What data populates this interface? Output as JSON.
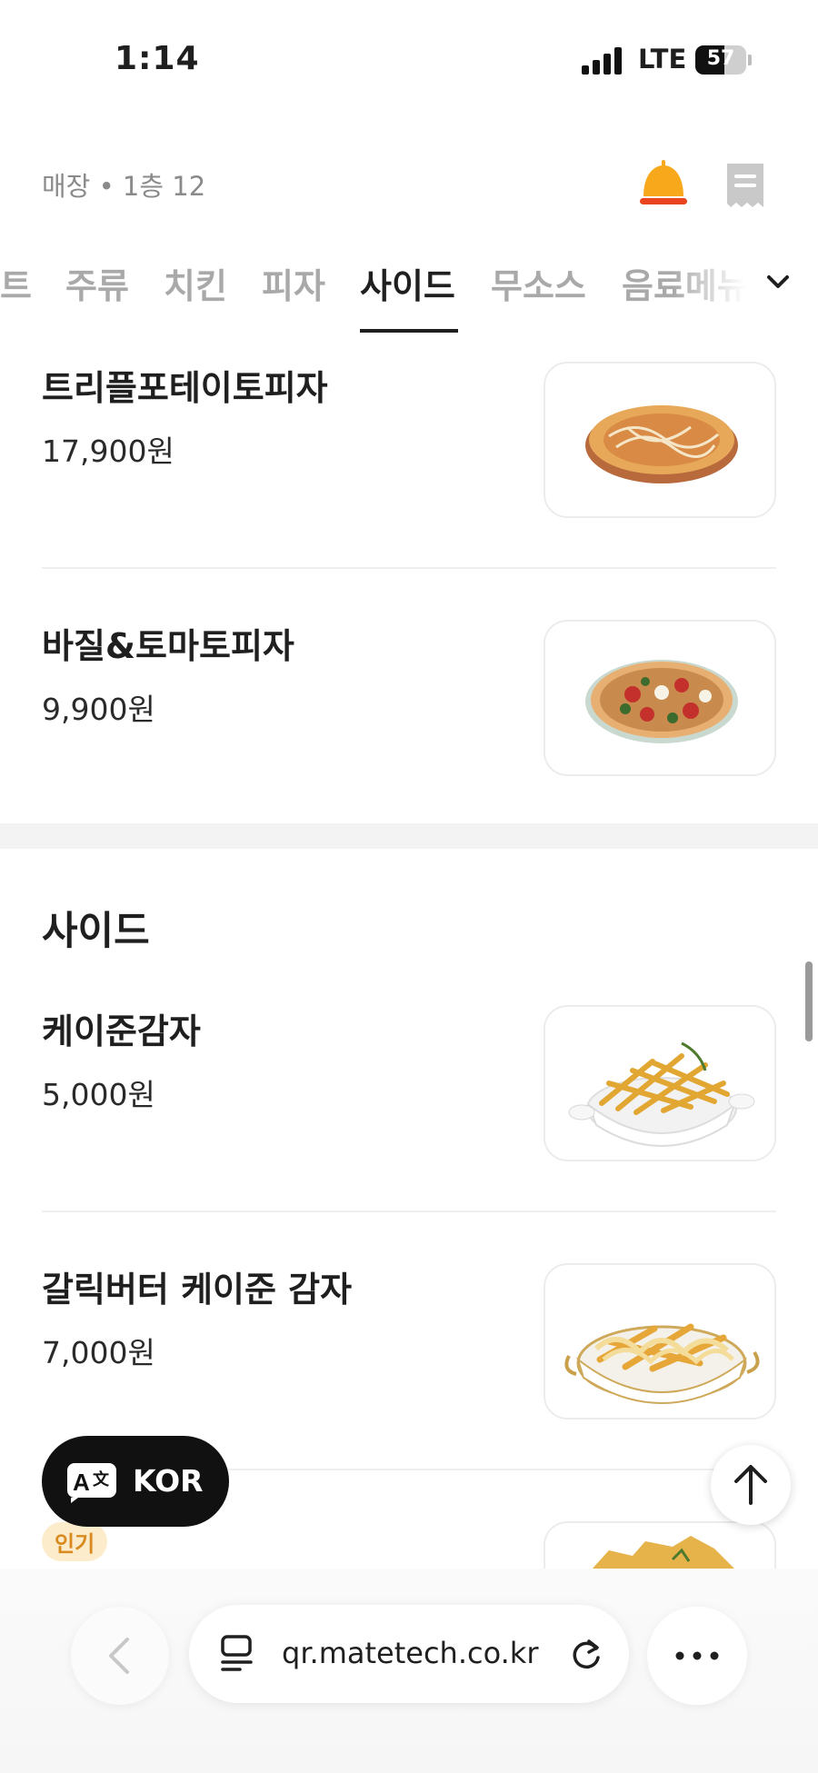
{
  "status_bar": {
    "time": "1:14",
    "network": "LTE",
    "battery": "57",
    "battery_level": 0.57
  },
  "header": {
    "store_info": "매장 • 1층 12",
    "bell_icon": "bell-icon",
    "receipt_icon": "receipt-icon"
  },
  "tabs": [
    {
      "label": "트"
    },
    {
      "label": "주류"
    },
    {
      "label": "치킨"
    },
    {
      "label": "피자"
    },
    {
      "label": "사이드"
    },
    {
      "label": "무소스"
    },
    {
      "label": "음료메뉴"
    }
  ],
  "active_tab": "사이드",
  "pizza_items": [
    {
      "name": "트리플포테이토피자",
      "price": "17,900원"
    },
    {
      "name": "바질&토마토피자",
      "price": "9,900원"
    }
  ],
  "side_section": {
    "title": "사이드",
    "items": [
      {
        "name": "케이준감자",
        "price": "5,000원"
      },
      {
        "name": "갈릭버터 케이준 감자",
        "price": "7,000원"
      }
    ],
    "next_badge": "인기"
  },
  "lang_button": {
    "label": "KOR",
    "icon": "translate-icon"
  },
  "browser": {
    "url": "qr.matetech.co.kr",
    "back_icon": "chevron-left-icon",
    "reload_icon": "reload-icon",
    "more_icon": "more-icon"
  },
  "colors": {
    "accent_bell": "#F7A81B",
    "badge_bg": "#FDECCB",
    "badge_text": "#D98A1E",
    "lang_bg": "#111111"
  }
}
